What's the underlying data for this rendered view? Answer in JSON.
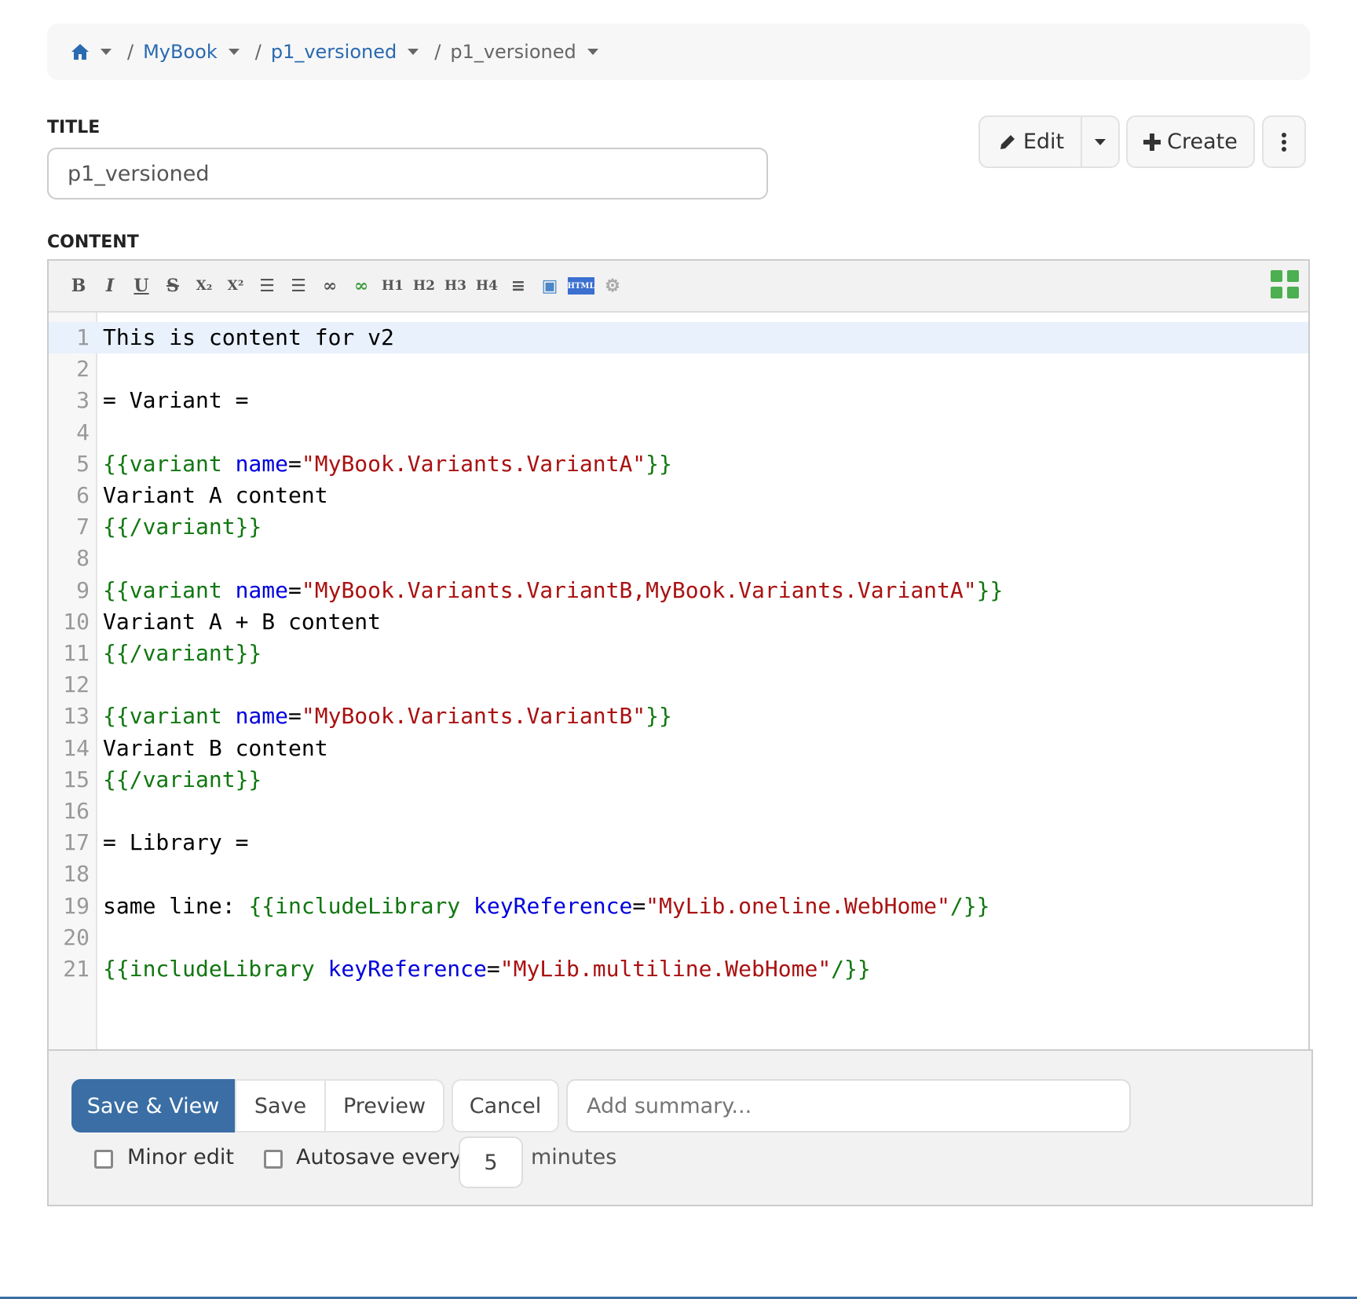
{
  "breadcrumb": {
    "home_icon": "home-icon",
    "items": [
      {
        "label": "MyBook"
      },
      {
        "label": "p1_versioned"
      },
      {
        "label": "p1_versioned"
      }
    ],
    "separator": "/"
  },
  "title": {
    "label": "TITLE",
    "value": "p1_versioned"
  },
  "actions": {
    "edit_label": "Edit",
    "create_label": "Create",
    "more_icon": "ellipsis-vertical-icon"
  },
  "content": {
    "label": "CONTENT"
  },
  "toolbar": {
    "buttons": [
      {
        "name": "bold",
        "glyph": "B"
      },
      {
        "name": "italic",
        "glyph": "I"
      },
      {
        "name": "underline",
        "glyph": "U"
      },
      {
        "name": "strikethrough",
        "glyph": "S"
      },
      {
        "name": "subscript",
        "glyph": "X₂"
      },
      {
        "name": "superscript",
        "glyph": "X²"
      },
      {
        "name": "bulleted-list",
        "glyph": "☰"
      },
      {
        "name": "numbered-list",
        "glyph": "☰"
      },
      {
        "name": "link",
        "glyph": "∞"
      },
      {
        "name": "link-external",
        "glyph": "∞"
      },
      {
        "name": "heading-1",
        "glyph": "H1"
      },
      {
        "name": "heading-2",
        "glyph": "H2"
      },
      {
        "name": "heading-3",
        "glyph": "H3"
      },
      {
        "name": "heading-4",
        "glyph": "H4"
      },
      {
        "name": "horizontal-rule",
        "glyph": "≡"
      },
      {
        "name": "image",
        "glyph": "▣"
      },
      {
        "name": "html",
        "glyph": "HTML"
      },
      {
        "name": "macro-settings",
        "glyph": "⚙"
      }
    ],
    "fullscreen_icon": "fullscreen-icon"
  },
  "colors": {
    "link": "#2a6ab0",
    "primary": "#3a6ea5",
    "macro": "#117711",
    "attribute": "#0000dd",
    "string": "#aa1111"
  },
  "code_lines": [
    [
      [
        "plain",
        "This is content for v2"
      ]
    ],
    [],
    [
      [
        "plain",
        "= Variant ="
      ]
    ],
    [],
    [
      [
        "macro",
        "{{variant "
      ],
      [
        "attr",
        "name"
      ],
      [
        "plain",
        "="
      ],
      [
        "str",
        "\"MyBook.Variants.VariantA\""
      ],
      [
        "macro",
        "}}"
      ]
    ],
    [
      [
        "plain",
        "Variant A content"
      ]
    ],
    [
      [
        "macro",
        "{{/variant}}"
      ]
    ],
    [],
    [
      [
        "macro",
        "{{variant "
      ],
      [
        "attr",
        "name"
      ],
      [
        "plain",
        "="
      ],
      [
        "str",
        "\"MyBook.Variants.VariantB,MyBook.Variants.VariantA\""
      ],
      [
        "macro",
        "}}"
      ]
    ],
    [
      [
        "plain",
        "Variant A + B content"
      ]
    ],
    [
      [
        "macro",
        "{{/variant}}"
      ]
    ],
    [],
    [
      [
        "macro",
        "{{variant "
      ],
      [
        "attr",
        "name"
      ],
      [
        "plain",
        "="
      ],
      [
        "str",
        "\"MyBook.Variants.VariantB\""
      ],
      [
        "macro",
        "}}"
      ]
    ],
    [
      [
        "plain",
        "Variant B content"
      ]
    ],
    [
      [
        "macro",
        "{{/variant}}"
      ]
    ],
    [],
    [
      [
        "plain",
        "= Library ="
      ]
    ],
    [],
    [
      [
        "plain",
        "same line: "
      ],
      [
        "macro",
        "{{includeLibrary "
      ],
      [
        "attr",
        "keyReference"
      ],
      [
        "plain",
        "="
      ],
      [
        "str",
        "\"MyLib.oneline.WebHome\""
      ],
      [
        "macro",
        "/}}"
      ]
    ],
    [],
    [
      [
        "macro",
        "{{includeLibrary "
      ],
      [
        "attr",
        "keyReference"
      ],
      [
        "plain",
        "="
      ],
      [
        "str",
        "\"MyLib.multiline.WebHome\""
      ],
      [
        "macro",
        "/}}"
      ]
    ]
  ],
  "footer": {
    "save_view_label": "Save & View",
    "save_label": "Save",
    "preview_label": "Preview",
    "cancel_label": "Cancel",
    "summary_placeholder": "Add summary...",
    "minor_edit_label": "Minor edit",
    "minor_edit_checked": false,
    "autosave_label": "Autosave every",
    "autosave_checked": false,
    "autosave_minutes": "5",
    "minutes_label": "minutes"
  }
}
